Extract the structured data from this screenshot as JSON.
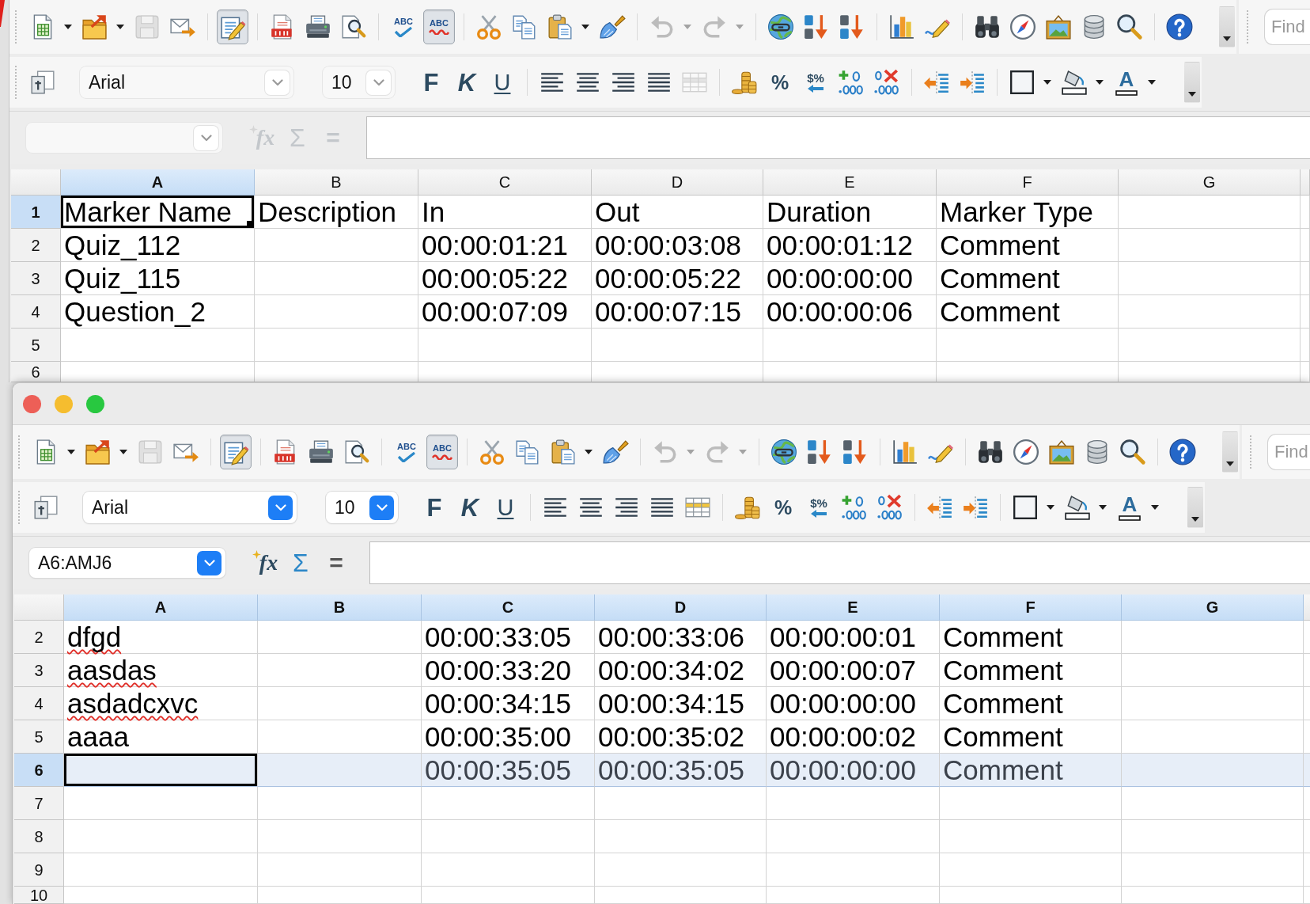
{
  "windows": [
    {
      "active": false,
      "standard_toolbar": {
        "groups": [
          [
            {
              "kind": "new",
              "disabled": false,
              "pressed": false
            },
            {
              "kind": "dropdown_arrow",
              "disabled": false,
              "pressed": false
            },
            {
              "kind": "open",
              "disabled": false,
              "pressed": false
            },
            {
              "kind": "dropdown_arrow",
              "disabled": false,
              "pressed": false
            },
            {
              "kind": "save",
              "disabled": true,
              "pressed": false
            },
            {
              "kind": "email",
              "disabled": false,
              "pressed": false
            }
          ],
          [
            {
              "kind": "edit_file",
              "disabled": false,
              "pressed": true
            }
          ],
          [
            {
              "kind": "export_pdf",
              "disabled": false,
              "pressed": false
            },
            {
              "kind": "print",
              "disabled": false,
              "pressed": false
            },
            {
              "kind": "page_preview",
              "disabled": false,
              "pressed": false
            }
          ],
          [
            {
              "kind": "spellcheck",
              "label": "ABC",
              "disabled": false,
              "pressed": false
            },
            {
              "kind": "autospellcheck",
              "label": "ABC",
              "disabled": false,
              "pressed": true
            }
          ],
          [
            {
              "kind": "cut",
              "disabled": false,
              "pressed": false
            },
            {
              "kind": "copy",
              "disabled": false,
              "pressed": false
            },
            {
              "kind": "paste",
              "disabled": false,
              "pressed": false
            },
            {
              "kind": "dropdown_arrow",
              "disabled": false,
              "pressed": false
            },
            {
              "kind": "clone_format",
              "disabled": false,
              "pressed": false
            }
          ],
          [
            {
              "kind": "undo",
              "disabled": true,
              "pressed": false
            },
            {
              "kind": "dropdown_arrow",
              "disabled": true,
              "pressed": false
            },
            {
              "kind": "redo",
              "disabled": true,
              "pressed": false
            },
            {
              "kind": "dropdown_arrow",
              "disabled": true,
              "pressed": false
            }
          ],
          [
            {
              "kind": "hyperlink",
              "disabled": false,
              "pressed": false
            },
            {
              "kind": "sort_ascending",
              "disabled": false,
              "pressed": false
            },
            {
              "kind": "sort_descending",
              "disabled": false,
              "pressed": false
            }
          ],
          [
            {
              "kind": "chart",
              "disabled": false,
              "pressed": false
            },
            {
              "kind": "draw_functions",
              "disabled": false,
              "pressed": false
            }
          ],
          [
            {
              "kind": "find_replace",
              "disabled": false,
              "pressed": false
            },
            {
              "kind": "navigator",
              "disabled": false,
              "pressed": false
            },
            {
              "kind": "gallery",
              "disabled": false,
              "pressed": false
            },
            {
              "kind": "data_sources",
              "disabled": false,
              "pressed": false
            },
            {
              "kind": "zoom",
              "disabled": false,
              "pressed": false
            }
          ],
          [
            {
              "kind": "help",
              "disabled": false,
              "pressed": false
            }
          ]
        ]
      },
      "find_toolbar": {
        "placeholder": "Find"
      },
      "formatting_toolbar": {
        "leading": [
          {
            "kind": "styles",
            "disabled": false,
            "pressed": false
          }
        ],
        "font_name": "Arial",
        "font_size": "10",
        "groups": [
          [
            {
              "kind": "bold",
              "label": "F",
              "disabled": false,
              "pressed": false
            },
            {
              "kind": "italic",
              "label": "K",
              "disabled": false,
              "pressed": false
            },
            {
              "kind": "underline",
              "label": "U",
              "disabled": false,
              "pressed": false
            }
          ],
          [
            {
              "kind": "align_left",
              "disabled": false,
              "pressed": false
            },
            {
              "kind": "align_center",
              "disabled": false,
              "pressed": false
            },
            {
              "kind": "align_right",
              "disabled": false,
              "pressed": false
            },
            {
              "kind": "justify",
              "disabled": false,
              "pressed": false
            },
            {
              "kind": "merge_cells",
              "disabled": true,
              "pressed": false
            }
          ],
          [
            {
              "kind": "currency",
              "disabled": false,
              "pressed": false
            },
            {
              "kind": "percent",
              "label": "%",
              "disabled": false,
              "pressed": false
            },
            {
              "kind": "number_standard",
              "label": "$%",
              "disabled": false,
              "pressed": false
            },
            {
              "kind": "add_decimal",
              "disabled": false,
              "pressed": false
            },
            {
              "kind": "delete_decimal",
              "disabled": false,
              "pressed": false
            }
          ],
          [
            {
              "kind": "decrease_indent",
              "disabled": false,
              "pressed": false
            },
            {
              "kind": "increase_indent",
              "disabled": false,
              "pressed": false
            }
          ],
          [
            {
              "kind": "borders",
              "disabled": false,
              "pressed": false
            },
            {
              "kind": "dropdown_arrow",
              "disabled": false,
              "pressed": false
            },
            {
              "kind": "background_color",
              "disabled": false,
              "pressed": false
            },
            {
              "kind": "dropdown_arrow",
              "disabled": false,
              "pressed": false
            },
            {
              "kind": "font_color",
              "label": "A",
              "disabled": false,
              "pressed": false
            },
            {
              "kind": "dropdown_arrow",
              "disabled": false,
              "pressed": false
            }
          ]
        ]
      },
      "formula_bar": {
        "buttons": [
          {
            "kind": "function_wizard",
            "label": "fx",
            "disabled": true
          },
          {
            "kind": "sum",
            "label": "Σ",
            "disabled": true
          },
          {
            "kind": "formula",
            "label": "=",
            "disabled": true
          }
        ]
      },
      "sheet": {
        "fill_handle": true,
        "columns": [
          {
            "label": "A",
            "selected": true,
            "cursor": true
          },
          {
            "label": "B",
            "selected": false,
            "cursor": false
          },
          {
            "label": "C",
            "selected": false,
            "cursor": false
          },
          {
            "label": "D",
            "selected": false,
            "cursor": false
          },
          {
            "label": "E",
            "selected": false,
            "cursor": false
          },
          {
            "label": "F",
            "selected": false,
            "cursor": false
          },
          {
            "label": "G",
            "selected": false,
            "cursor": false
          }
        ],
        "rows": [
          {
            "number": "1",
            "selected": true,
            "highlighted": false,
            "cursor": true,
            "misspelled": false,
            "cells": [
              "Marker Name",
              "Description",
              "In",
              "Out",
              "Duration",
              "Marker Type"
            ]
          },
          {
            "number": "2",
            "selected": false,
            "highlighted": false,
            "cursor": false,
            "misspelled": false,
            "cells": [
              "Quiz_112",
              null,
              "00:00:01:21",
              "00:00:03:08",
              "00:00:01:12",
              "Comment"
            ]
          },
          {
            "number": "3",
            "selected": false,
            "highlighted": false,
            "cursor": false,
            "misspelled": false,
            "cells": [
              "Quiz_115",
              null,
              "00:00:05:22",
              "00:00:05:22",
              "00:00:00:00",
              "Comment"
            ]
          },
          {
            "number": "4",
            "selected": false,
            "highlighted": false,
            "cursor": false,
            "misspelled": false,
            "cells": [
              "Question_2",
              null,
              "00:00:07:09",
              "00:00:07:15",
              "00:00:00:06",
              "Comment"
            ]
          },
          {
            "number": "5",
            "selected": false,
            "highlighted": false,
            "cursor": false
          },
          {
            "number": "6",
            "selected": false,
            "highlighted": false,
            "cursor": false
          }
        ]
      }
    },
    {
      "active": true,
      "title_bar": {
        "buttons": [
          {
            "color": "#ed5f57"
          },
          {
            "color": "#f5bd2f"
          },
          {
            "color": "#28c840"
          }
        ]
      },
      "standard_toolbar": {
        "groups": [
          [
            {
              "kind": "new",
              "disabled": false,
              "pressed": false
            },
            {
              "kind": "dropdown_arrow",
              "disabled": false,
              "pressed": false
            },
            {
              "kind": "open",
              "disabled": false,
              "pressed": false
            },
            {
              "kind": "dropdown_arrow",
              "disabled": false,
              "pressed": false
            },
            {
              "kind": "save",
              "disabled": true,
              "pressed": false
            },
            {
              "kind": "email",
              "disabled": false,
              "pressed": false
            }
          ],
          [
            {
              "kind": "edit_file",
              "disabled": false,
              "pressed": true
            }
          ],
          [
            {
              "kind": "export_pdf",
              "disabled": false,
              "pressed": false
            },
            {
              "kind": "print",
              "disabled": false,
              "pressed": false
            },
            {
              "kind": "page_preview",
              "disabled": false,
              "pressed": false
            }
          ],
          [
            {
              "kind": "spellcheck",
              "label": "ABC",
              "disabled": false,
              "pressed": false
            },
            {
              "kind": "autospellcheck",
              "label": "ABC",
              "disabled": false,
              "pressed": true
            }
          ],
          [
            {
              "kind": "cut",
              "disabled": false,
              "pressed": false
            },
            {
              "kind": "copy",
              "disabled": false,
              "pressed": false
            },
            {
              "kind": "paste",
              "disabled": false,
              "pressed": false
            },
            {
              "kind": "dropdown_arrow",
              "disabled": false,
              "pressed": false
            },
            {
              "kind": "clone_format",
              "disabled": false,
              "pressed": false
            }
          ],
          [
            {
              "kind": "undo",
              "disabled": true,
              "pressed": false
            },
            {
              "kind": "dropdown_arrow",
              "disabled": true,
              "pressed": false
            },
            {
              "kind": "redo",
              "disabled": true,
              "pressed": false
            },
            {
              "kind": "dropdown_arrow",
              "disabled": true,
              "pressed": false
            }
          ],
          [
            {
              "kind": "hyperlink",
              "disabled": false,
              "pressed": false
            },
            {
              "kind": "sort_ascending",
              "disabled": false,
              "pressed": false
            },
            {
              "kind": "sort_descending",
              "disabled": false,
              "pressed": false
            }
          ],
          [
            {
              "kind": "chart",
              "disabled": false,
              "pressed": false
            },
            {
              "kind": "draw_functions",
              "disabled": false,
              "pressed": false
            }
          ],
          [
            {
              "kind": "find_replace",
              "disabled": false,
              "pressed": false
            },
            {
              "kind": "navigator",
              "disabled": false,
              "pressed": false
            },
            {
              "kind": "gallery",
              "disabled": false,
              "pressed": false
            },
            {
              "kind": "data_sources",
              "disabled": false,
              "pressed": false
            },
            {
              "kind": "zoom",
              "disabled": false,
              "pressed": false
            }
          ],
          [
            {
              "kind": "help",
              "disabled": false,
              "pressed": false
            }
          ]
        ]
      },
      "find_toolbar": {
        "placeholder": "Find"
      },
      "formatting_toolbar": {
        "leading": [
          {
            "kind": "styles",
            "disabled": false,
            "pressed": false
          }
        ],
        "font_name": "Arial",
        "font_size": "10",
        "groups": [
          [
            {
              "kind": "bold",
              "label": "F",
              "disabled": false,
              "pressed": false
            },
            {
              "kind": "italic",
              "label": "K",
              "disabled": false,
              "pressed": false
            },
            {
              "kind": "underline",
              "label": "U",
              "disabled": false,
              "pressed": false
            }
          ],
          [
            {
              "kind": "align_left",
              "disabled": false,
              "pressed": false
            },
            {
              "kind": "align_center",
              "disabled": false,
              "pressed": false
            },
            {
              "kind": "align_right",
              "disabled": false,
              "pressed": false
            },
            {
              "kind": "justify",
              "disabled": false,
              "pressed": false
            },
            {
              "kind": "merge_cells",
              "disabled": false,
              "pressed": false
            }
          ],
          [
            {
              "kind": "currency",
              "disabled": false,
              "pressed": false
            },
            {
              "kind": "percent",
              "label": "%",
              "disabled": false,
              "pressed": false
            },
            {
              "kind": "number_standard",
              "label": "$%",
              "disabled": false,
              "pressed": false
            },
            {
              "kind": "add_decimal",
              "disabled": false,
              "pressed": false
            },
            {
              "kind": "delete_decimal",
              "disabled": false,
              "pressed": false
            }
          ],
          [
            {
              "kind": "decrease_indent",
              "disabled": false,
              "pressed": false
            },
            {
              "kind": "increase_indent",
              "disabled": false,
              "pressed": false
            }
          ],
          [
            {
              "kind": "borders",
              "disabled": false,
              "pressed": false
            },
            {
              "kind": "dropdown_arrow",
              "disabled": false,
              "pressed": false
            },
            {
              "kind": "background_color",
              "disabled": false,
              "pressed": false
            },
            {
              "kind": "dropdown_arrow",
              "disabled": false,
              "pressed": false
            },
            {
              "kind": "font_color",
              "label": "A",
              "disabled": false,
              "pressed": false
            },
            {
              "kind": "dropdown_arrow",
              "disabled": false,
              "pressed": false
            }
          ]
        ]
      },
      "formula_bar": {
        "name_box": "A6:AMJ6",
        "buttons": [
          {
            "kind": "function_wizard",
            "label": "fx",
            "disabled": false
          },
          {
            "kind": "sum",
            "label": "Σ",
            "disabled": false
          },
          {
            "kind": "formula",
            "label": "=",
            "disabled": false
          }
        ]
      },
      "sheet": {
        "fill_handle": false,
        "columns": [
          {
            "label": "A",
            "selected": true,
            "cursor": true
          },
          {
            "label": "B",
            "selected": true,
            "cursor": false
          },
          {
            "label": "C",
            "selected": true,
            "cursor": false
          },
          {
            "label": "D",
            "selected": true,
            "cursor": false
          },
          {
            "label": "E",
            "selected": true,
            "cursor": false
          },
          {
            "label": "F",
            "selected": true,
            "cursor": false
          },
          {
            "label": "G",
            "selected": true,
            "cursor": false
          }
        ],
        "rows": [
          {
            "number": "2",
            "selected": false,
            "highlighted": false,
            "cursor": false,
            "misspelled": true,
            "cells": [
              "dfgd",
              null,
              "00:00:33:05",
              "00:00:33:06",
              "00:00:00:01",
              "Comment"
            ]
          },
          {
            "number": "3",
            "selected": false,
            "highlighted": false,
            "cursor": false,
            "misspelled": true,
            "cells": [
              "aasdas",
              null,
              "00:00:33:20",
              "00:00:34:02",
              "00:00:00:07",
              "Comment"
            ]
          },
          {
            "number": "4",
            "selected": false,
            "highlighted": false,
            "cursor": false,
            "misspelled": true,
            "cells": [
              "asdadcxvc",
              null,
              "00:00:34:15",
              "00:00:34:15",
              "00:00:00:00",
              "Comment"
            ]
          },
          {
            "number": "5",
            "selected": false,
            "highlighted": false,
            "cursor": false,
            "misspelled": false,
            "cells": [
              "aaaa",
              null,
              "00:00:35:00",
              "00:00:35:02",
              "00:00:00:02",
              "Comment"
            ]
          },
          {
            "number": "6",
            "selected": true,
            "highlighted": true,
            "cursor": true,
            "cells": [
              null,
              null,
              "00:00:35:05",
              "00:00:35:05",
              "00:00:00:00",
              "Comment"
            ]
          },
          {
            "number": "7",
            "selected": false,
            "highlighted": false,
            "cursor": false
          },
          {
            "number": "8",
            "selected": false,
            "highlighted": false,
            "cursor": false
          },
          {
            "number": "9",
            "selected": false,
            "highlighted": false,
            "cursor": false
          },
          {
            "number": "10",
            "selected": false,
            "highlighted": false,
            "cursor": false
          }
        ]
      }
    }
  ]
}
